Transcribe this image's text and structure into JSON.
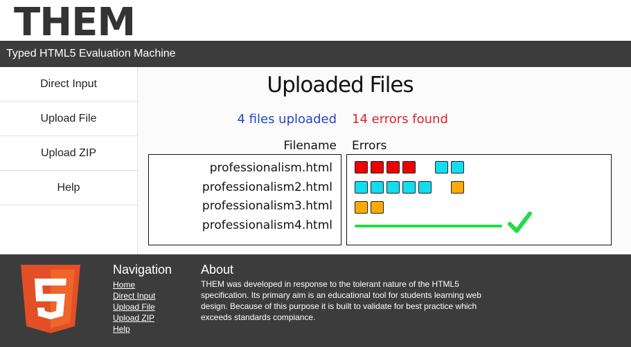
{
  "header": {
    "logo": "THEM",
    "subtitle": "Typed HTML5 Evaluation Machine"
  },
  "sidebar": {
    "items": [
      {
        "label": "Direct Input"
      },
      {
        "label": "Upload File"
      },
      {
        "label": "Upload ZIP"
      },
      {
        "label": "Help"
      }
    ]
  },
  "main": {
    "title": "Uploaded Files",
    "files_uploaded": "4 files uploaded",
    "errors_found": "14 errors found",
    "col_filename": "Filename",
    "col_errors": "Errors",
    "files": [
      {
        "name": "professionalism.html",
        "errors": [
          "red",
          "red",
          "red",
          "red",
          "cyan",
          "cyan"
        ]
      },
      {
        "name": "professionalism2.html",
        "errors": [
          "cyan",
          "cyan",
          "cyan",
          "cyan",
          "cyan",
          "orange"
        ]
      },
      {
        "name": "professionalism3.html",
        "errors": [
          "orange",
          "orange"
        ]
      },
      {
        "name": "professionalism4.html",
        "errors": []
      }
    ],
    "colors": {
      "red": "#ee0000",
      "cyan": "#11ddee",
      "orange": "#ffaa00",
      "ok": "#22dd44",
      "files_count": "#2244cc",
      "errors_count": "#dd2233"
    }
  },
  "footer": {
    "logo_icon": "html5-shield-icon",
    "nav_title": "Navigation",
    "nav_links": [
      {
        "label": "Home"
      },
      {
        "label": "Direct Input"
      },
      {
        "label": "Upload File"
      },
      {
        "label": "Upload ZIP"
      },
      {
        "label": "Help"
      }
    ],
    "about_title": "About",
    "about_text": "THEM was developed in response to the tolerant nature of the HTML5 specification. Its primary aim is an educational tool for students learning web design. Because of this purpose it is built to validate for best practice which exceeds standards compiance."
  }
}
